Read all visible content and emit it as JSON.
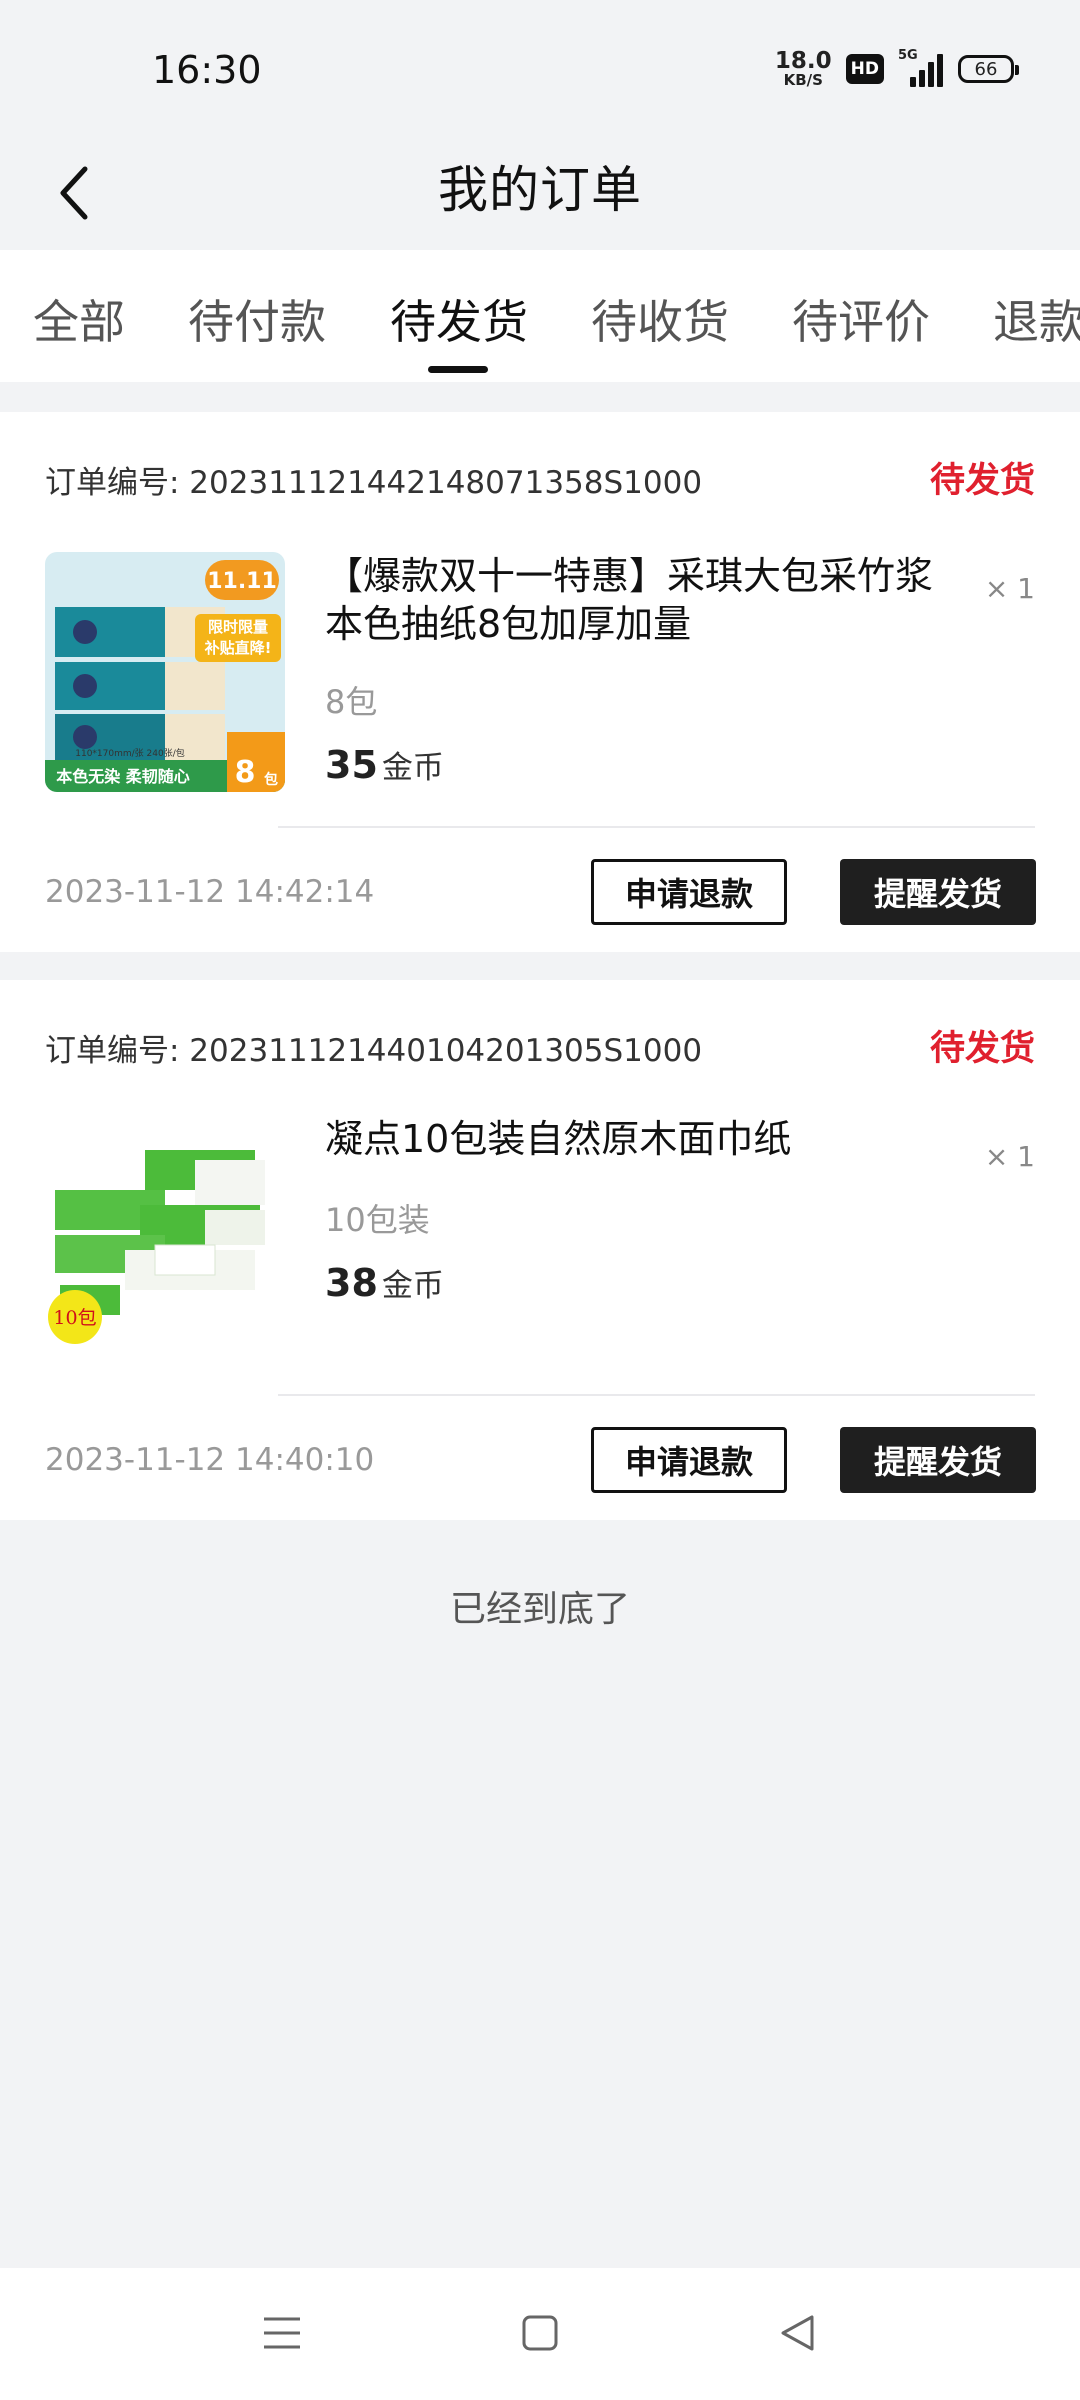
{
  "status_bar": {
    "time": "16:30",
    "net_speed_value": "18.0",
    "net_speed_unit": "KB/S",
    "hd_badge": "HD",
    "signal_label": "5G",
    "battery_level": "66"
  },
  "header": {
    "title": "我的订单",
    "back_icon": "chevron-left-icon"
  },
  "tabs": [
    {
      "label": "全部"
    },
    {
      "label": "待付款"
    },
    {
      "label": "待发货",
      "active": true
    },
    {
      "label": "待收货"
    },
    {
      "label": "待评价"
    },
    {
      "label": "退款"
    }
  ],
  "orders": [
    {
      "order_no": "订单编号: 20231112144214807135 8S1000",
      "status": "待发货",
      "product": {
        "title": "【爆款双十一特惠】采琪大包采竹浆本色抽纸8包加厚加量",
        "qty": "× 1",
        "spec": "8包",
        "price": "35",
        "price_unit": "金币",
        "thumb_badge": "11.11",
        "thumb_banner": "限时限量",
        "thumb_subbanner": "补贴直降!",
        "thumb_size": "110*170mm/张 240张/包",
        "thumb_bottom": "本色无染 柔韧随心",
        "thumb_count": "8",
        "thumb_count_unit": "包"
      },
      "time": "2023-11-12 14:42:14",
      "refund_label": "申请退款",
      "remind_label": "提醒发货"
    },
    {
      "order_no": "订单编号: 20231112144010420130 5S1000",
      "status": "待发货",
      "product": {
        "title": "凝点10包装自然原木面巾纸",
        "qty": "× 1",
        "spec": "10包装",
        "price": "38",
        "price_unit": "金币",
        "thumb_badge": "10包"
      },
      "time": "2023-11-12 14:40:10",
      "refund_label": "申请退款",
      "remind_label": "提醒发货"
    }
  ],
  "footer_text": "已经到底了",
  "nav": {
    "menu_icon": "menu-icon",
    "home_icon": "square-home-icon",
    "back_icon": "triangle-back-icon"
  },
  "colors": {
    "status_red": "#e0202e",
    "primary_button": "#1f1f1f",
    "page_bg": "#f2f3f5"
  }
}
